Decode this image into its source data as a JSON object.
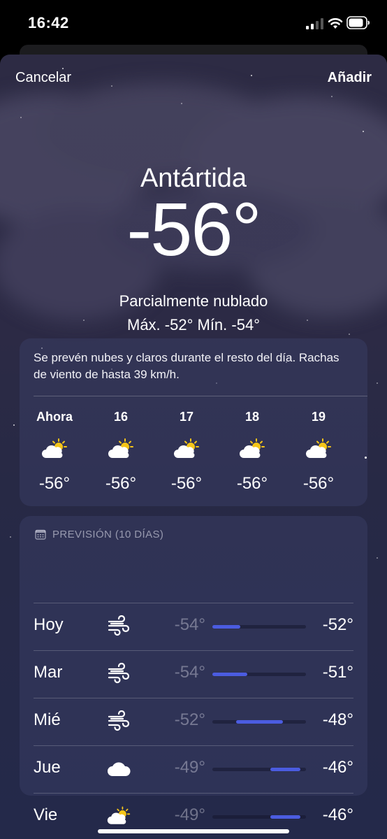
{
  "status_bar": {
    "time": "16:42"
  },
  "nav": {
    "cancel_label": "Cancelar",
    "add_label": "Añadir"
  },
  "current": {
    "location": "Antártida",
    "temperature": "-56°",
    "condition": "Parcialmente nublado",
    "high_low": "Máx. -52°  Mín. -54°"
  },
  "hourly": {
    "summary": "Se prevén nubes y claros durante el resto del día. Rachas de viento de hasta 39 km/h.",
    "hours": [
      {
        "label": "Ahora",
        "icon": "partly-cloudy-night-icon",
        "temp": "-56°"
      },
      {
        "label": "16",
        "icon": "partly-cloudy-night-icon",
        "temp": "-56°"
      },
      {
        "label": "17",
        "icon": "partly-cloudy-night-icon",
        "temp": "-56°"
      },
      {
        "label": "18",
        "icon": "partly-cloudy-night-icon",
        "temp": "-56°"
      },
      {
        "label": "19",
        "icon": "partly-cloudy-night-icon",
        "temp": "-56°"
      }
    ]
  },
  "forecast": {
    "header": "PREVISIÓN (10 DÍAS)",
    "days": [
      {
        "day": "Hoy",
        "icon": "wind-icon",
        "low": "-54°",
        "high": "-52°",
        "range_start": 0.0,
        "range_end": 0.3
      },
      {
        "day": "Mar",
        "icon": "wind-icon",
        "low": "-54°",
        "high": "-51°",
        "range_start": 0.0,
        "range_end": 0.37
      },
      {
        "day": "Mié",
        "icon": "wind-icon",
        "low": "-52°",
        "high": "-48°",
        "range_start": 0.25,
        "range_end": 0.75
      },
      {
        "day": "Jue",
        "icon": "cloud-icon",
        "low": "-49°",
        "high": "-46°",
        "range_start": 0.62,
        "range_end": 0.94
      },
      {
        "day": "Vie",
        "icon": "partly-cloudy-icon",
        "low": "-49°",
        "high": "-46°",
        "range_start": 0.62,
        "range_end": 0.94
      }
    ]
  },
  "colors": {
    "range_bar": "#4b5ce0",
    "sun": "#f5c518"
  }
}
